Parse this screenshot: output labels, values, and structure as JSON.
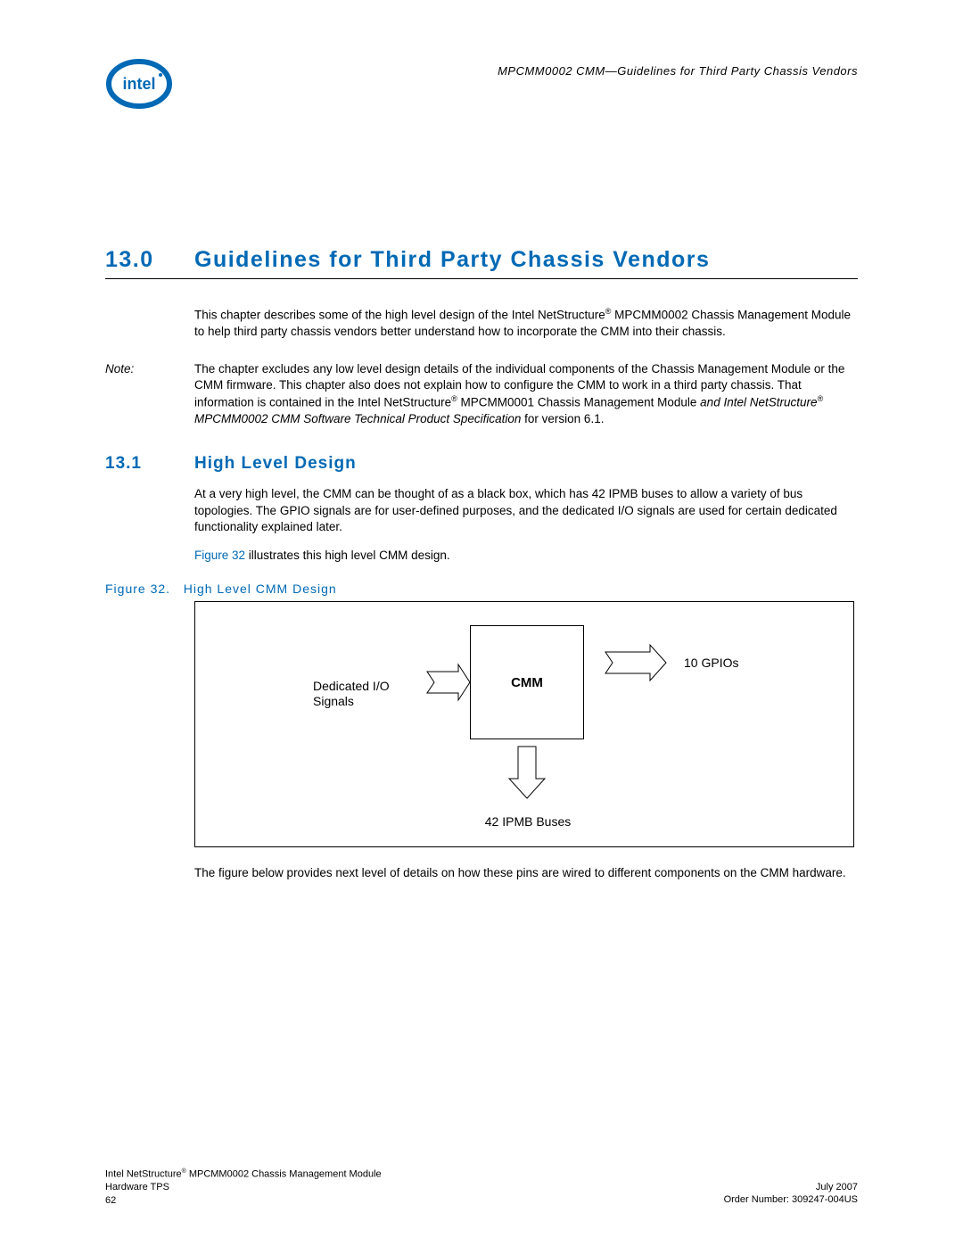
{
  "header": {
    "running": "MPCMM0002 CMM—Guidelines for Third Party Chassis Vendors"
  },
  "section": {
    "number": "13.0",
    "title": "Guidelines for Third Party Chassis Vendors"
  },
  "intro": {
    "p1_a": "This chapter describes some of the high level design of the Intel NetStructure",
    "p1_b": " MPCMM0002 Chassis Management Module to help third party chassis vendors better understand how to incorporate the CMM into their chassis."
  },
  "note": {
    "label": "Note:",
    "a": "The chapter excludes any low level design details of the individual components of the Chassis Management Module or the CMM firmware. This chapter also does not explain how to configure the CMM to work in a third party chassis. That information is contained in the Intel NetStructure",
    "b": " MPCMM0001 Chassis Management Module ",
    "c": "and Intel NetStructure",
    "d": " MPCMM0002 CMM Software Technical Product Specification",
    "e": " for version 6.1."
  },
  "subsection": {
    "number": "13.1",
    "title": "High Level Design"
  },
  "hl": {
    "p1": "At a very high level, the CMM can be thought of as a black box, which has 42 IPMB buses to allow a variety of bus topologies. The GPIO signals are for user-defined purposes, and the dedicated I/O signals are used for certain dedicated functionality explained later.",
    "p2a": "Figure 32",
    "p2b": " illustrates this high level CMM design."
  },
  "figure": {
    "caption_a": "Figure 32.",
    "caption_b": "High Level CMM Design",
    "cmm": "CMM",
    "dedicated": "Dedicated I/O Signals",
    "gpio": "10 GPIOs",
    "ipmb": "42 IPMB Buses"
  },
  "post_fig": "The figure below provides next level of details on how these pins are wired to different components on the CMM hardware.",
  "footer": {
    "l1a": "Intel NetStructure",
    "l1b": " MPCMM0002 Chassis Management Module",
    "l2": "Hardware TPS",
    "l3": "62",
    "r1": "July 2007",
    "r2": "Order Number: 309247-004US"
  }
}
